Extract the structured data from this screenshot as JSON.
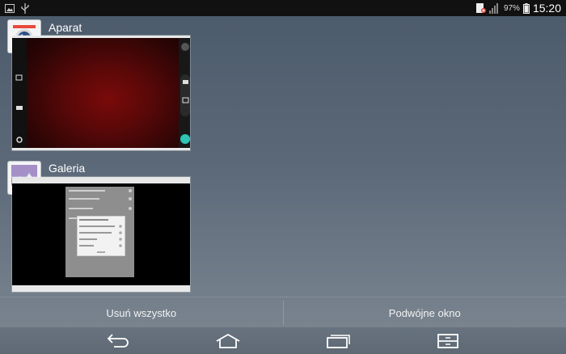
{
  "status_bar": {
    "battery_percent": "97%",
    "time": "15:20",
    "icons": [
      "image-icon",
      "usb-icon",
      "sim-error-icon",
      "signal-icon",
      "battery-icon"
    ]
  },
  "recent_apps": [
    {
      "name": "Aparat",
      "icon": "camera-app-icon"
    },
    {
      "name": "Galeria",
      "icon": "gallery-app-icon"
    }
  ],
  "actions": {
    "clear_all": "Usuń wszystko",
    "dual_window": "Podwójne okno"
  },
  "nav": {
    "icons": [
      "back-icon",
      "home-icon",
      "recent-apps-icon",
      "dual-window-icon"
    ]
  }
}
